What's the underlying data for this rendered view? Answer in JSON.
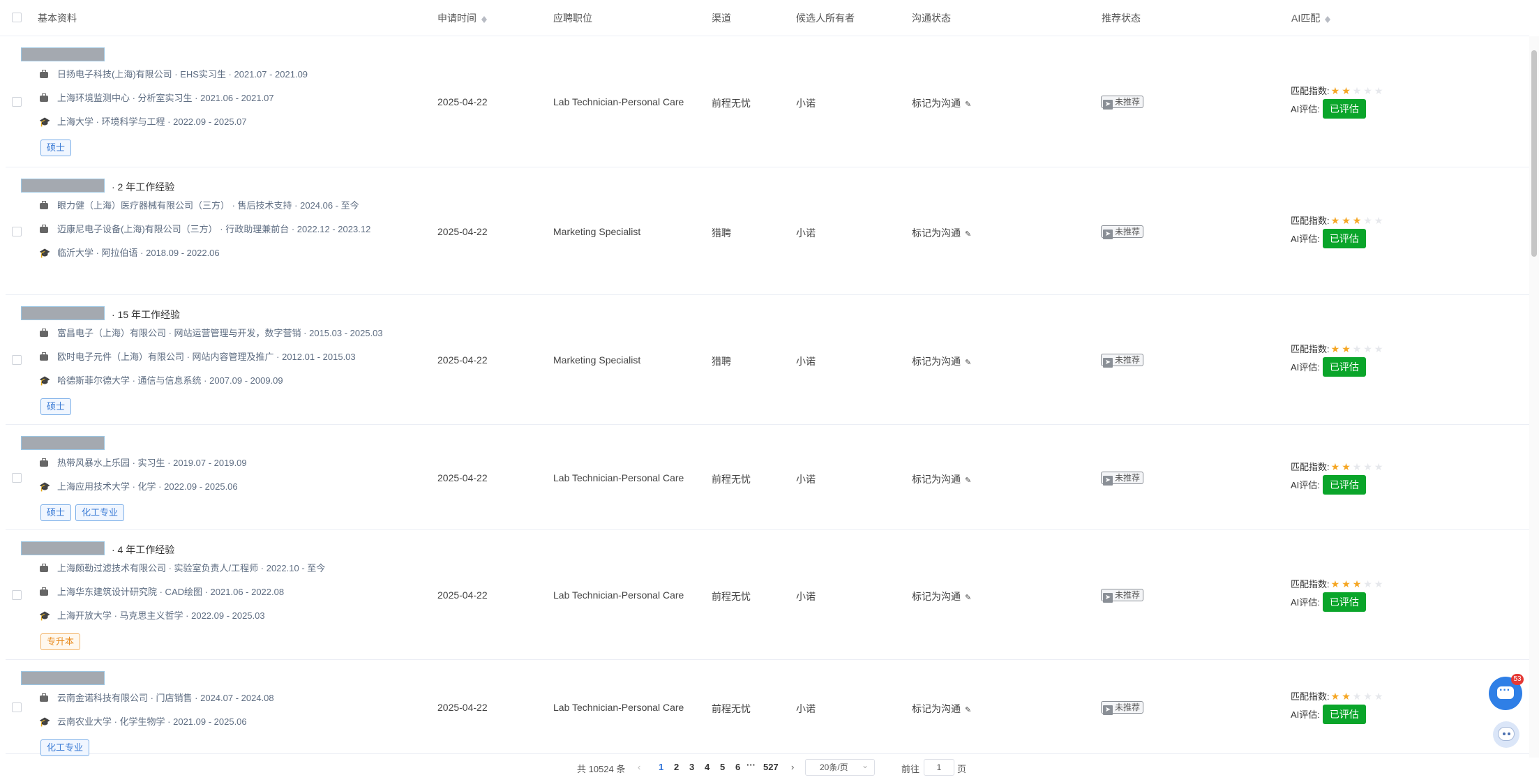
{
  "header": {
    "basic": "基本资料",
    "apply_time": "申请时间",
    "position": "应聘职位",
    "channel": "渠道",
    "owner": "候选人所有者",
    "comm": "沟通状态",
    "recommend": "推荐状态",
    "ai_match": "AI匹配"
  },
  "labels": {
    "match_index": "匹配指数:",
    "ai_eval": "AI评估:",
    "evaluated": "已评估",
    "mark_comm": "标记为沟通",
    "not_recommended": "未推荐"
  },
  "rows": [
    {
      "experience": "",
      "lines": [
        {
          "icon": "briefcase",
          "text": "日扬电子科技(上海)有限公司 · EHS实习生 · 2021.07 - 2021.09"
        },
        {
          "icon": "briefcase",
          "text": "上海环境监测中心 · 分析室实习生 · 2021.06 - 2021.07"
        },
        {
          "icon": "graduation-cap",
          "text": "上海大学 · 环境科学与工程 · 2022.09 - 2025.07"
        }
      ],
      "tags": [
        {
          "text": "硕士",
          "color": "blue"
        }
      ],
      "date": "2025-04-22",
      "position": "Lab Technician-Personal Care",
      "channel": "前程无忧",
      "owner": "小诺",
      "stars": 2
    },
    {
      "experience": "· 2 年工作经验",
      "lines": [
        {
          "icon": "briefcase",
          "text": "眼力健（上海）医疗器械有限公司（三方） · 售后技术支持 · 2024.06 - 至今"
        },
        {
          "icon": "briefcase",
          "text": "迈康尼电子设备(上海)有限公司（三方） · 行政助理兼前台 · 2022.12 - 2023.12"
        },
        {
          "icon": "graduation-cap",
          "text": "临沂大学 · 阿拉伯语 · 2018.09 - 2022.06"
        }
      ],
      "tags": [],
      "date": "2025-04-22",
      "position": "Marketing Specialist",
      "channel": "猎聘",
      "owner": "小诺",
      "stars": 3
    },
    {
      "experience": "· 15 年工作经验",
      "lines": [
        {
          "icon": "briefcase",
          "text": "富昌电子（上海）有限公司 · 网站运营管理与开发，数字营销 · 2015.03 - 2025.03"
        },
        {
          "icon": "briefcase",
          "text": "欧时电子元件（上海）有限公司 · 网站内容管理及推广 · 2012.01 - 2015.03"
        },
        {
          "icon": "graduation-cap",
          "text": "哈德斯菲尔德大学 · 通信与信息系统 · 2007.09 - 2009.09"
        }
      ],
      "tags": [
        {
          "text": "硕士",
          "color": "blue"
        }
      ],
      "date": "2025-04-22",
      "position": "Marketing Specialist",
      "channel": "猎聘",
      "owner": "小诺",
      "stars": 2
    },
    {
      "experience": "",
      "lines": [
        {
          "icon": "briefcase",
          "text": "热带风暴水上乐园 · 实习生 · 2019.07 - 2019.09"
        },
        {
          "icon": "graduation-cap",
          "text": "上海应用技术大学 · 化学 · 2022.09 - 2025.06"
        }
      ],
      "tags": [
        {
          "text": "硕士",
          "color": "blue"
        },
        {
          "text": "化工专业",
          "color": "blue"
        }
      ],
      "date": "2025-04-22",
      "position": "Lab Technician-Personal Care",
      "channel": "前程无忧",
      "owner": "小诺",
      "stars": 2
    },
    {
      "experience": "· 4 年工作经验",
      "lines": [
        {
          "icon": "briefcase",
          "text": "上海颇勒过滤技术有限公司 · 实验室负责人/工程师 · 2022.10 - 至今"
        },
        {
          "icon": "briefcase",
          "text": "上海华东建筑设计研究院 · CAD绘图 · 2021.06 - 2022.08"
        },
        {
          "icon": "graduation-cap",
          "text": "上海开放大学 · 马克思主义哲学 · 2022.09 - 2025.03"
        }
      ],
      "tags": [
        {
          "text": "专升本",
          "color": "orange"
        }
      ],
      "date": "2025-04-22",
      "position": "Lab Technician-Personal Care",
      "channel": "前程无忧",
      "owner": "小诺",
      "stars": 3
    },
    {
      "experience": "",
      "lines": [
        {
          "icon": "briefcase",
          "text": "云南金诺科技有限公司 · 门店销售 · 2024.07 - 2024.08"
        },
        {
          "icon": "graduation-cap",
          "text": "云南农业大学 · 化学生物学 · 2021.09 - 2025.06"
        }
      ],
      "tags": [
        {
          "text": "化工专业",
          "color": "blue"
        }
      ],
      "date": "2025-04-22",
      "position": "Lab Technician-Personal Care",
      "channel": "前程无忧",
      "owner": "小诺",
      "stars": 2
    }
  ],
  "pagination": {
    "total": "共 10524 条",
    "pages": [
      "1",
      "2",
      "3",
      "4",
      "5",
      "6"
    ],
    "ellipsis": "···",
    "last": "527",
    "page_size": "20条/页",
    "goto_label": "前往",
    "goto_value": "1",
    "goto_suffix": "页"
  },
  "chat_badge": "53"
}
